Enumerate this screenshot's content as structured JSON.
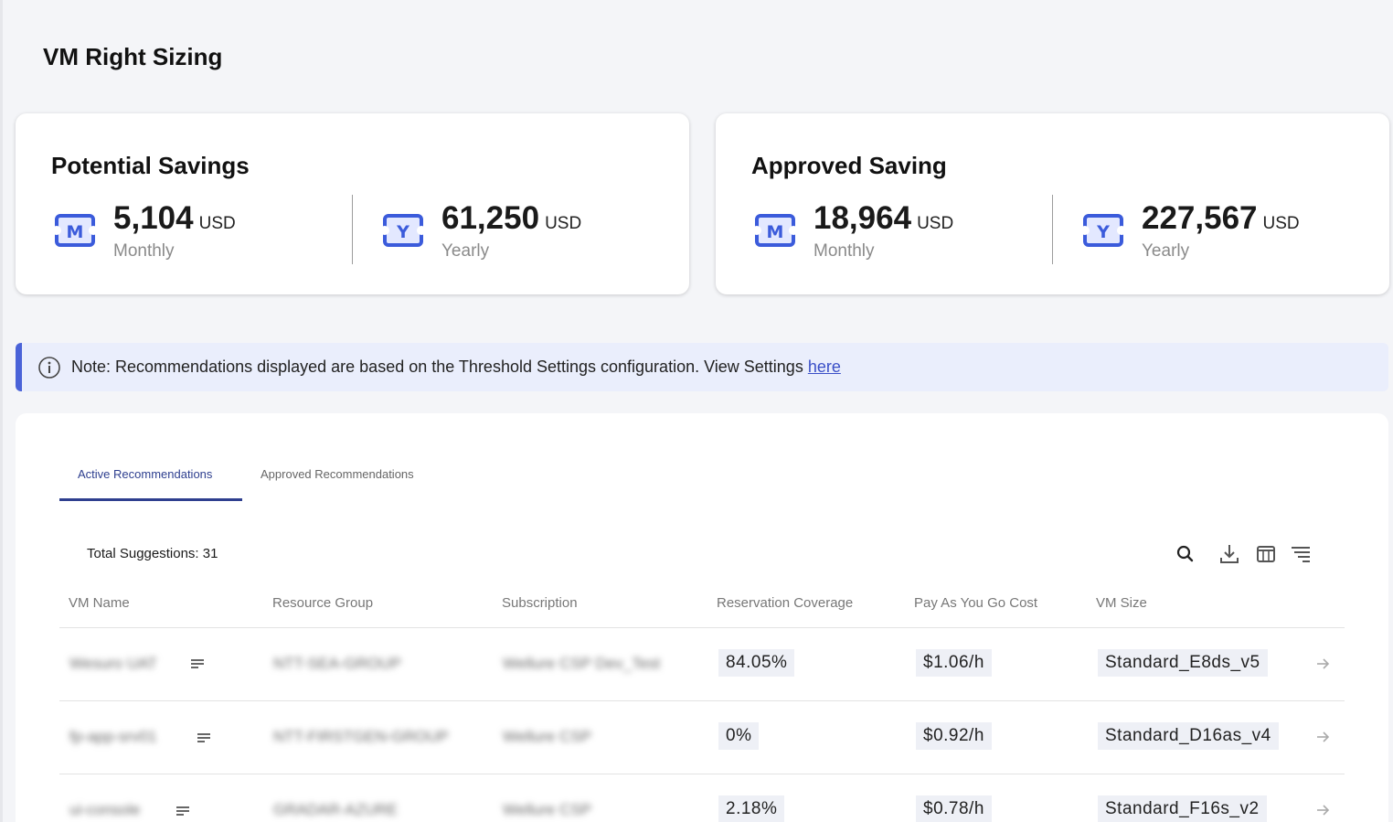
{
  "page": {
    "title": "VM Right Sizing"
  },
  "potential_savings": {
    "title": "Potential Savings",
    "monthly": {
      "value": "5,104",
      "unit": "USD",
      "period": "Monthly",
      "icon": "calendar-m-icon"
    },
    "yearly": {
      "value": "61,250",
      "unit": "USD",
      "period": "Yearly",
      "icon": "calendar-y-icon"
    }
  },
  "approved_saving": {
    "title": "Approved Saving",
    "monthly": {
      "value": "18,964",
      "unit": "USD",
      "period": "Monthly",
      "icon": "calendar-m-icon"
    },
    "yearly": {
      "value": "227,567",
      "unit": "USD",
      "period": "Yearly",
      "icon": "calendar-y-icon"
    }
  },
  "note": {
    "text": "Note: Recommendations displayed are based on the Threshold Settings configuration. View Settings ",
    "link": "here"
  },
  "tabs": [
    {
      "label": "Active Recommendations",
      "active": true
    },
    {
      "label": "Approved Recommendations",
      "active": false
    }
  ],
  "table": {
    "total_label": "Total Suggestions: 31",
    "toolbar": [
      "search-icon",
      "download-icon",
      "columns-icon",
      "filter-icon"
    ],
    "columns": [
      "VM Name",
      "Resource Group",
      "Subscription",
      "Reservation Coverage",
      "Pay As You Go Cost",
      "VM Size"
    ],
    "rows": [
      {
        "vm_name": "Wesuro UAT",
        "resource_group": "NTT-SEA-GROUP",
        "subscription": "Wellure CSP Dev_Test",
        "coverage": "84.05%",
        "cost": "$1.06/h",
        "size": "Standard_E8ds_v5"
      },
      {
        "vm_name": "fp-app-srv01",
        "resource_group": "NTT-FIRSTGEN-GROUP",
        "subscription": "Wellure CSP",
        "coverage": "0%",
        "cost": "$0.92/h",
        "size": "Standard_D16as_v4"
      },
      {
        "vm_name": "ui-console",
        "resource_group": "GRADAR-AZURE",
        "subscription": "Wellure CSP",
        "coverage": "2.18%",
        "cost": "$0.78/h",
        "size": "Standard_F16s_v2"
      }
    ]
  },
  "colors": {
    "accent": "#4a63d8",
    "tab_active": "#2e3f8f",
    "note_bg": "#eaeefc",
    "pill_bg": "#eef0f6"
  }
}
